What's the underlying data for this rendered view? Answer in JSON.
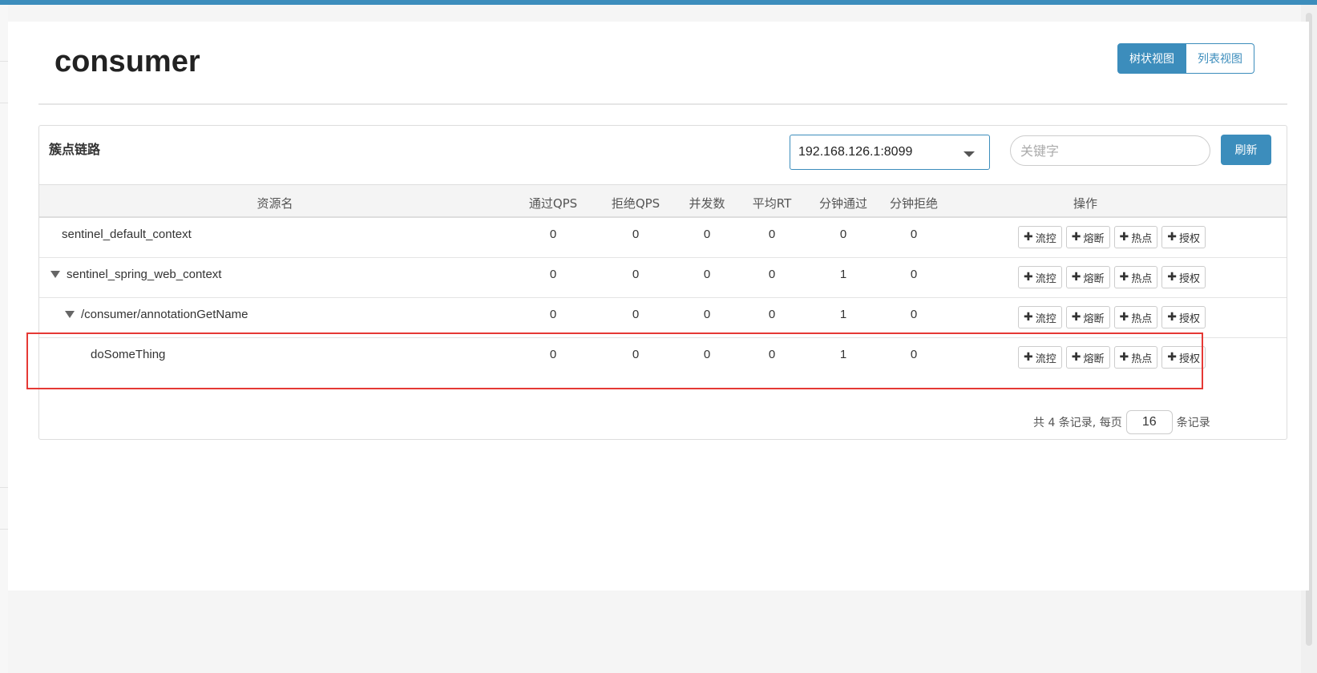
{
  "page": {
    "title": "consumer"
  },
  "view_toggle": {
    "tree_label": "树状视图",
    "list_label": "列表视图",
    "active": "tree"
  },
  "panel": {
    "title": "簇点链路",
    "machine_selected": "192.168.126.1:8099",
    "search_placeholder": "关键字",
    "refresh_label": "刷新"
  },
  "table": {
    "headers": [
      "资源名",
      "通过QPS",
      "拒绝QPS",
      "并发数",
      "平均RT",
      "分钟通过",
      "分钟拒绝",
      "操作"
    ],
    "rows": [
      {
        "name": "sentinel_default_context",
        "expandable": false,
        "values": [
          "0",
          "0",
          "0",
          "0",
          "0",
          "0"
        ]
      },
      {
        "name": "sentinel_spring_web_context",
        "expandable": true,
        "values": [
          "0",
          "0",
          "0",
          "0",
          "1",
          "0"
        ]
      },
      {
        "name": "/consumer/annotationGetName",
        "expandable": true,
        "values": [
          "0",
          "0",
          "0",
          "0",
          "1",
          "0"
        ]
      },
      {
        "name": "doSomeThing",
        "expandable": false,
        "values": [
          "0",
          "0",
          "0",
          "0",
          "1",
          "0"
        ]
      }
    ],
    "actions": [
      "流控",
      "熔断",
      "热点",
      "授权"
    ]
  },
  "pager": {
    "prefix": "共 4 条记录, 每页",
    "page_size": "16",
    "suffix": "条记录"
  },
  "colors": {
    "accent": "#3c8dbc",
    "highlight": "#e53935"
  }
}
